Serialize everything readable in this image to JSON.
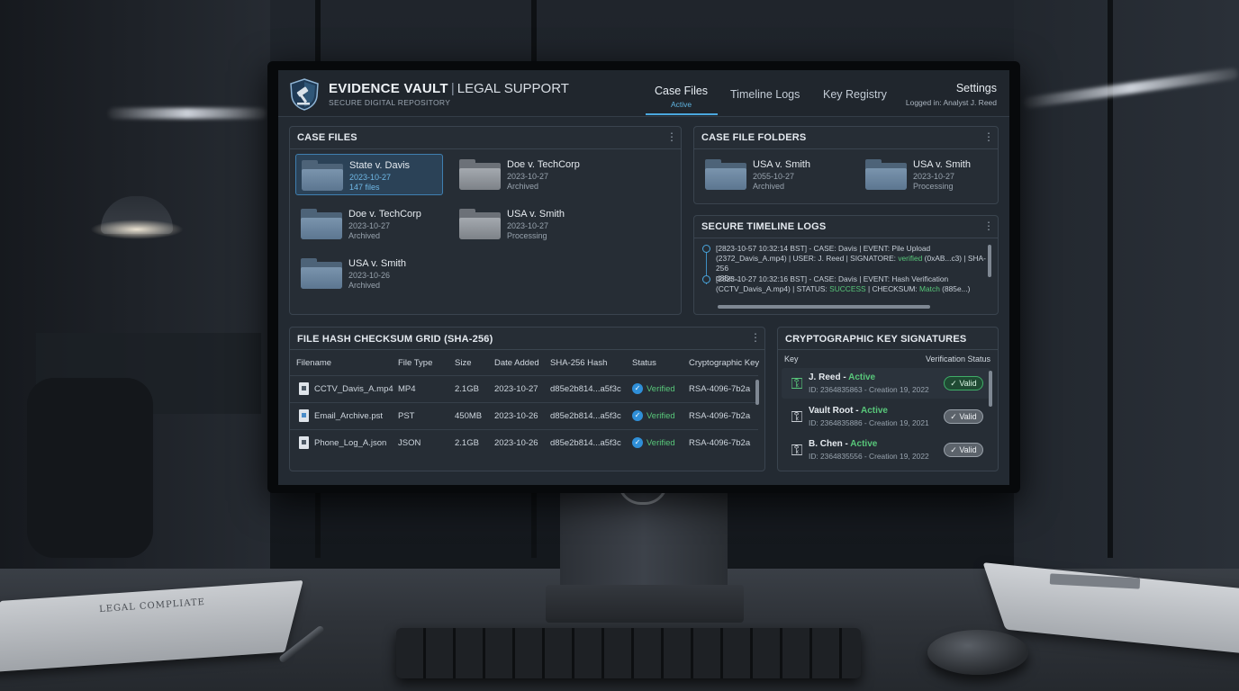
{
  "header": {
    "brand_main": "EVIDENCE VAULT",
    "brand_sep": "|",
    "brand_suffix": "LEGAL SUPPORT",
    "subtitle": "SECURE DIGITAL REPOSITORY",
    "tabs": [
      {
        "label": "Case Files",
        "sub": "Active"
      },
      {
        "label": "Timeline Logs"
      },
      {
        "label": "Key Registry"
      }
    ],
    "settings_label": "Settings",
    "login_text": "Logged in: Analyst J. Reed"
  },
  "case_files": {
    "title": "CASE FILES",
    "menu_icon": "kebab-menu-icon",
    "items": [
      {
        "name": "State v. Davis",
        "date": "2023-10-27",
        "status": "147 files"
      },
      {
        "name": "Doe v. TechCorp",
        "date": "2023-10-27",
        "status": "Archived"
      },
      {
        "name": "Doe v. TechCorp",
        "date": "2023-10-27",
        "status": "Archived"
      },
      {
        "name": "USA v. Smith",
        "date": "2023-10-27",
        "status": "Processing"
      },
      {
        "name": "USA v. Smith",
        "date": "2023-10-26",
        "status": "Archived"
      }
    ]
  },
  "case_file_folders": {
    "title": "CASE FILE FOLDERS",
    "items": [
      {
        "name": "USA v. Smith",
        "date": "2055-10-27",
        "status": "Archived"
      },
      {
        "name": "USA v. Smith",
        "date": "2023-10-27",
        "status": "Processing"
      }
    ]
  },
  "timeline": {
    "title": "SECURE TIMELINE LOGS",
    "entries": [
      {
        "line1": "[2823-10-57 10:32:14 BST] - CASE: Davis | EVENT: Pile Upload",
        "line2a": "(2372_Davis_A.mp4) | USER: J. Reed | SIGNATORE: ",
        "line2ok": "verified",
        "line2b": " (0xAB...c3) | SHA-256",
        "line3": "d85e..."
      },
      {
        "line1": "[2823-10-27 10:32:16 BST] - CASE: Davis | EVENT: Hash Verification",
        "line2a": "(CCTV_Davis_A.mp4) | STATUS: ",
        "line2ok": "SUCCESS",
        "line2b": " | CHECKSUM: ",
        "line2ok2": "Match",
        "line2c": " (885e...)"
      }
    ]
  },
  "hash_grid": {
    "title": "FILE HASH CHECKSUM GRID (SHA-256)",
    "columns": [
      "Filename",
      "File Type",
      "Size",
      "Date Added",
      "SHA-256 Hash",
      "Status",
      "Cryptographic Key"
    ],
    "rows": [
      {
        "icon": "video-file-icon",
        "filename": "CCTV_Davis_A.mp4",
        "type": "MP4",
        "size": "2.1GB",
        "date": "2023-10-27",
        "hash": "d85e2b814...a5f3c",
        "status": "Verified",
        "key": "RSA-4096-7b2a"
      },
      {
        "icon": "document-file-icon",
        "filename": "Email_Archive.pst",
        "type": "PST",
        "size": "450MB",
        "date": "2023-10-26",
        "hash": "d85e2b814...a5f3c",
        "status": "Verified",
        "key": "RSA-4096-7b2a"
      },
      {
        "icon": "file-icon",
        "filename": "Phone_Log_A.json",
        "type": "JSON",
        "size": "2.1GB",
        "date": "2023-10-26",
        "hash": "d85e2b814...a5f3c",
        "status": "Verified",
        "key": "RSA-4096-7b2a"
      }
    ]
  },
  "key_signatures": {
    "title": "CRYPTOGRAPHIC KEY SIGNATURES",
    "col_key": "Key",
    "col_status": "Verification Status",
    "rows": [
      {
        "name": "J. Reed",
        "state": "Active",
        "id": "ID: 2364835863 - Creation 19, 2022",
        "badge": "Valid",
        "icon_color": "#58c77a"
      },
      {
        "name": "Vault Root",
        "state": "Active",
        "id": "ID: 2364835886 - Creation 19, 2021",
        "badge": "Valid",
        "icon_color": "#c9ced4"
      },
      {
        "name": "B. Chen",
        "state": "Active",
        "id": "ID: 2364835556 - Creation 19, 2022",
        "badge": "Valid",
        "icon_color": "#c9ced4"
      }
    ]
  },
  "desk": {
    "paper_title": "LEGAL COMPLIATE"
  },
  "colors": {
    "accent": "#4aa7de",
    "success": "#58c77a",
    "panel": "#262d35"
  }
}
